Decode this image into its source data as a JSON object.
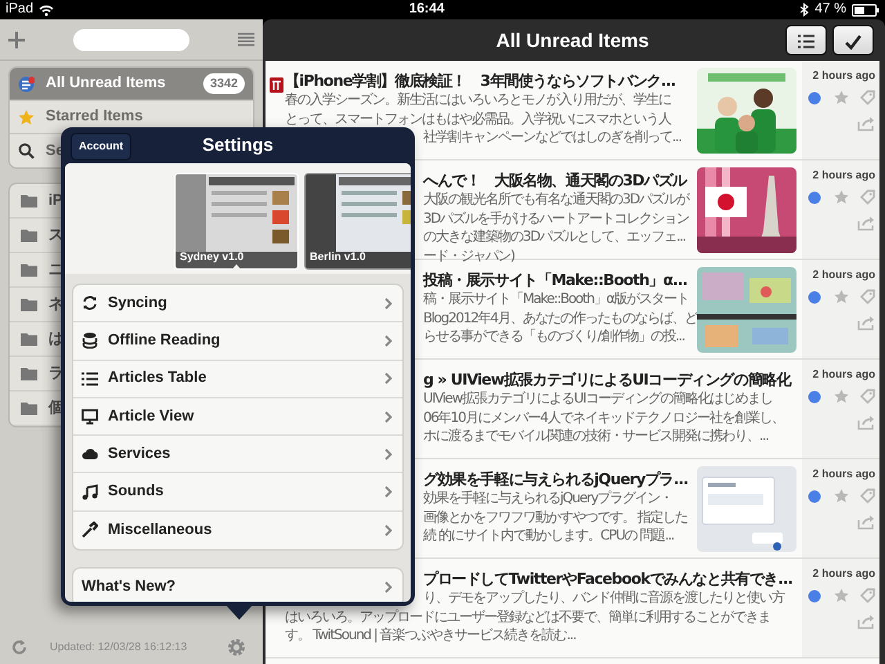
{
  "status_bar": {
    "device": "iPad",
    "time": "16:44",
    "battery": "47 %"
  },
  "sidebar": {
    "items": [
      {
        "label": "All Unread Items",
        "kind": "all",
        "count": "3342",
        "selected": true
      },
      {
        "label": "Starred Items",
        "kind": "starred",
        "selected": false
      },
      {
        "label": "Se",
        "kind": "search",
        "selected": false
      }
    ],
    "folders": [
      "iP",
      "ス",
      "ニ",
      "ネ",
      "は",
      "ラ",
      "個"
    ],
    "updated": "Updated: 12/03/28 16:12:13"
  },
  "header": {
    "title": "All Unread Items"
  },
  "articles": [
    {
      "source_icon": true,
      "title": "【iPhone学割】徹底検証！　3年間使うならソフトバンク...",
      "lines": [
        {
          "text": "春の入学シーズン。新生活にはいろいろとモノが入り用だが、学生に",
          "kind": "full"
        },
        {
          "text": "とって、スマートフォンはもはや必需品。入学祝いにスマホという人",
          "kind": "full"
        },
        {
          "text": "社学割キャンペーンなどではしのぎを削って...",
          "kind": "cut"
        }
      ],
      "thumbnail": {
        "kind": "picture"
      },
      "time": "2 hours ago",
      "unread": true,
      "starred": false
    },
    {
      "title": "へんで！　大阪名物、通天閣の3Dパズル",
      "title_cut": true,
      "lines": [
        {
          "text": "大阪の観光名所でも有名な通天閣の3Dパズルが",
          "kind": "cut"
        },
        {
          "text": "3Dパズルを手がけるハートアートコレクション",
          "kind": "cut"
        },
        {
          "text": "の大きな建築物の3Dパズルとして、エッフェ...",
          "kind": "cut"
        },
        {
          "text": "ード・ジャパン)",
          "kind": "cut"
        }
      ],
      "thumbnail": {
        "kind": "picture"
      },
      "time": "2 hours ago",
      "unread": true,
      "starred": false
    },
    {
      "title": "投稿・展示サイト「Make::Booth」α...",
      "title_cut": true,
      "lines": [
        {
          "text": "稿・展示サイト「Make::Booth」α版がスタート",
          "kind": "cut"
        },
        {
          "text": "Blog2012年4月、あなたの作ったものならば、ど",
          "kind": "cut"
        },
        {
          "text": "らせる事ができる「ものづくり/創作物」の投...",
          "kind": "cut"
        }
      ],
      "thumbnail": {
        "kind": "picture"
      },
      "time": "2 hours ago",
      "unread": true,
      "starred": false
    },
    {
      "title": "g » UIView拡張カテゴリによるUIコーディングの簡略化",
      "title_cut": true,
      "lines": [
        {
          "text": "UIView拡張カテゴリによるUIコーディングの簡略化はじめまし",
          "kind": "cut"
        },
        {
          "text": "06年10月にメンバー4人でネイキッドテクノロジー社を創業し、",
          "kind": "cut"
        },
        {
          "text": "ホに渡るまでモバイル関連の技術・サービス開発に携わり、...",
          "kind": "cut"
        }
      ],
      "time": "2 hours ago",
      "unread": true,
      "starred": false
    },
    {
      "title": "グ効果を手軽に与えられるjQueryプラ...",
      "title_cut": true,
      "lines": [
        {
          "text": "効果を手軽に与えられるjQueryプラグイン・",
          "kind": "cut"
        },
        {
          "text": "画像とかをフワフワ動かすやつです。 指定した",
          "kind": "cut"
        },
        {
          "text": "続 的にサイト内で動かします。CPUの 問題...",
          "kind": "cut"
        }
      ],
      "thumbnail": {
        "kind": "picture"
      },
      "time": "2 hours ago",
      "unread": true,
      "starred": false
    },
    {
      "title": "プロードしてTwitterやFacebookでみんなと共有でき...",
      "title_cut": true,
      "lines": [
        {
          "text": "り、デモをアップしたり、バンド仲間に音源を渡したりと使い方",
          "kind": "cut"
        },
        {
          "text": "はいろいろ。アップロードにユーザー登録などは不要で、簡単に利用することができま",
          "kind": "full"
        },
        {
          "text": "す。 TwitSound | 音楽つぶやきサービス続きを読む...",
          "kind": "full"
        }
      ],
      "time": "2 hours ago",
      "unread": true,
      "starred": false
    }
  ],
  "settings": {
    "title": "Settings",
    "account_button": "Account",
    "themes": [
      {
        "label": "Sydney v1.0",
        "selected": true
      },
      {
        "label": "Berlin v1.0",
        "selected": false
      }
    ],
    "items": [
      "Syncing",
      "Offline Reading",
      "Articles Table",
      "Article View",
      "Services",
      "Sounds",
      "Miscellaneous"
    ],
    "extra_items": [
      "What's New?"
    ]
  }
}
